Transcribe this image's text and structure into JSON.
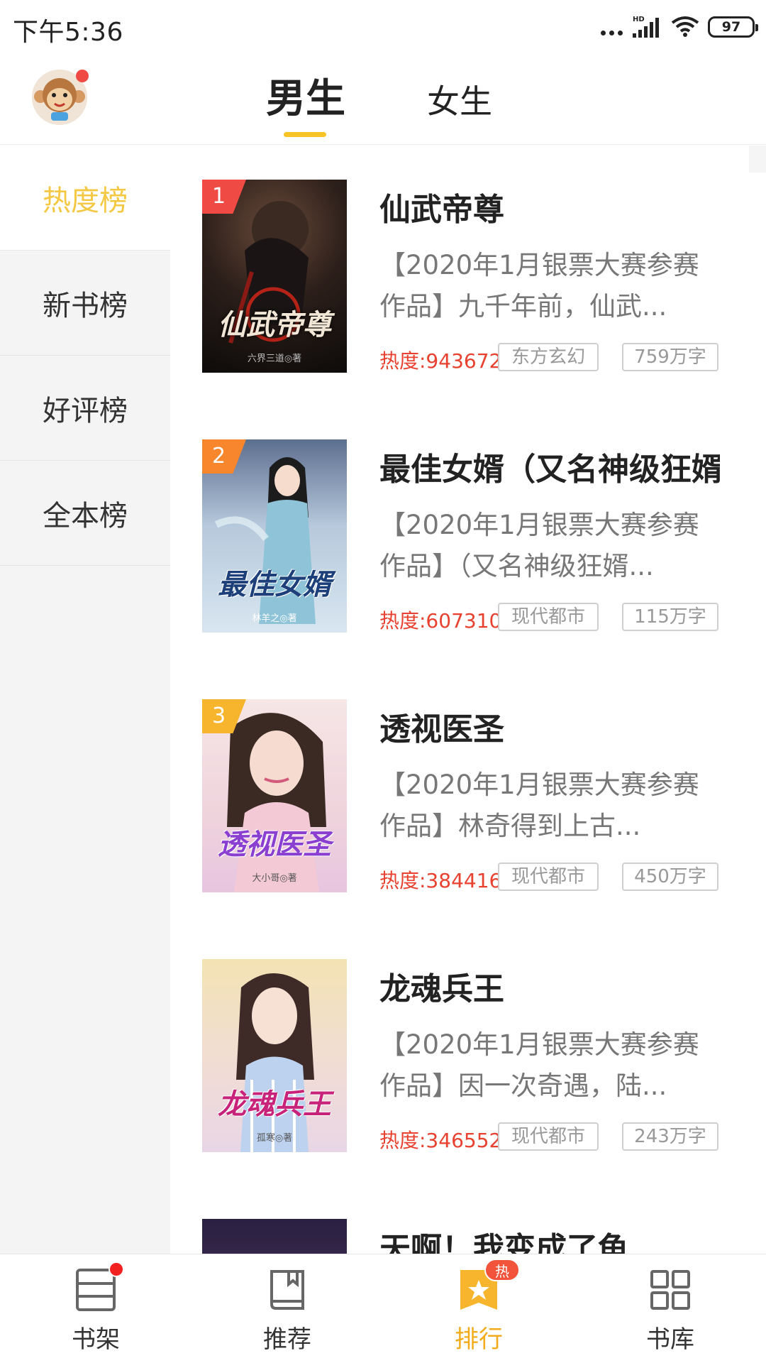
{
  "status_bar": {
    "time": "下午5:36",
    "network": "HD",
    "battery": "97"
  },
  "header": {
    "tabs": [
      {
        "label": "男生",
        "selected": true
      },
      {
        "label": "女生",
        "selected": false
      }
    ],
    "accent_color": "#f7c325"
  },
  "sidebar": {
    "items": [
      {
        "label": "热度榜",
        "active": true
      },
      {
        "label": "新书榜",
        "active": false
      },
      {
        "label": "好评榜",
        "active": false
      },
      {
        "label": "全本榜",
        "active": false
      }
    ]
  },
  "books": [
    {
      "rank": "1",
      "title": "仙武帝尊",
      "desc": "【2020年1月银票大赛参赛作品】九千年前，仙武...",
      "heat": "热度:943672",
      "genre": "东方玄幻",
      "words": "759万字",
      "cover_title": "仙武帝尊",
      "cover_author": "六界三道◎著",
      "badge_color": "#f04a45"
    },
    {
      "rank": "2",
      "title": "最佳女婿（又名神级狂婿）",
      "desc": "【2020年1月银票大赛参赛作品】（又名神级狂婿...",
      "heat": "热度:607310",
      "genre": "现代都市",
      "words": "115万字",
      "cover_title": "最佳女婿",
      "cover_author": "林羊之◎著",
      "badge_color": "#f7862d"
    },
    {
      "rank": "3",
      "title": "透视医圣",
      "desc": "【2020年1月银票大赛参赛作品】林奇得到上古...",
      "heat": "热度:384416",
      "genre": "现代都市",
      "words": "450万字",
      "cover_title": "透视医圣",
      "cover_author": "大小哥◎著",
      "badge_color": "#f7b52d"
    },
    {
      "rank": "",
      "title": "龙魂兵王",
      "desc": "【2020年1月银票大赛参赛作品】因一次奇遇，陆...",
      "heat": "热度:346552",
      "genre": "现代都市",
      "words": "243万字",
      "cover_title": "龙魂兵王",
      "cover_author": "孤寒◎著",
      "badge_color": ""
    },
    {
      "rank": "",
      "title": "天啊！我变成了龟",
      "desc": "",
      "heat": "",
      "genre": "",
      "words": "",
      "cover_title": "",
      "cover_author": "",
      "badge_color": ""
    }
  ],
  "bottom_nav": {
    "items": [
      {
        "label": "书架",
        "icon": "bookshelf-icon",
        "has_dot": true
      },
      {
        "label": "推荐",
        "icon": "book-icon"
      },
      {
        "label": "排行",
        "icon": "ranking-star-icon",
        "badge": "热",
        "active": true
      },
      {
        "label": "书库",
        "icon": "grid-icon"
      }
    ],
    "active_color": "#f2ab1a"
  }
}
